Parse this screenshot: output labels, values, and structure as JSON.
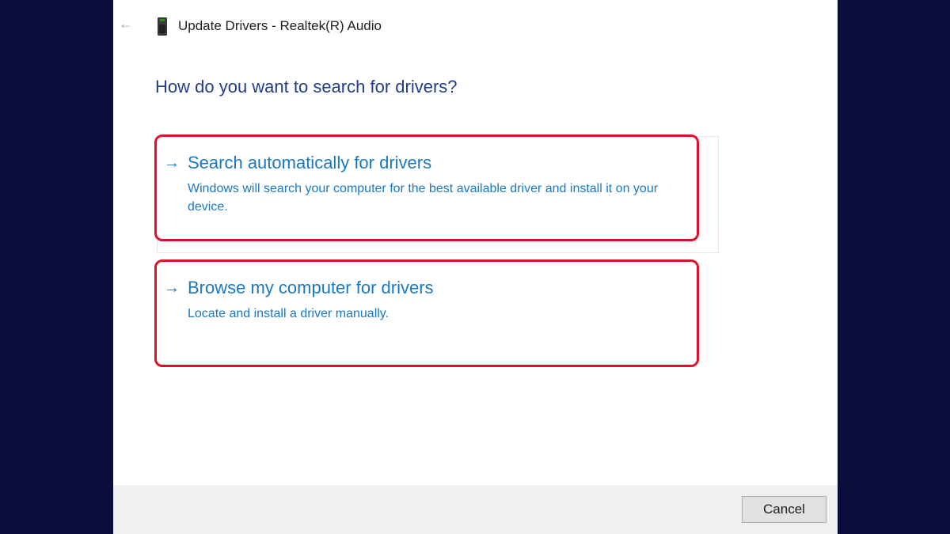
{
  "window": {
    "title": "Update Drivers - Realtek(R) Audio",
    "back_icon": "←",
    "device_icon": "audio-device-icon"
  },
  "heading": "How do you want to search for drivers?",
  "options": [
    {
      "arrow": "→",
      "title": "Search automatically for drivers",
      "description": "Windows will search your computer for the best available driver and install it on your device."
    },
    {
      "arrow": "→",
      "title": "Browse my computer for drivers",
      "description": "Locate and install a driver manually."
    }
  ],
  "footer": {
    "cancel_label": "Cancel"
  },
  "colors": {
    "background": "#0b0d3a",
    "heading": "#1f3e8c",
    "link": "#1a78c2",
    "highlight": "#e0102a",
    "footer": "#f0f0f0"
  }
}
